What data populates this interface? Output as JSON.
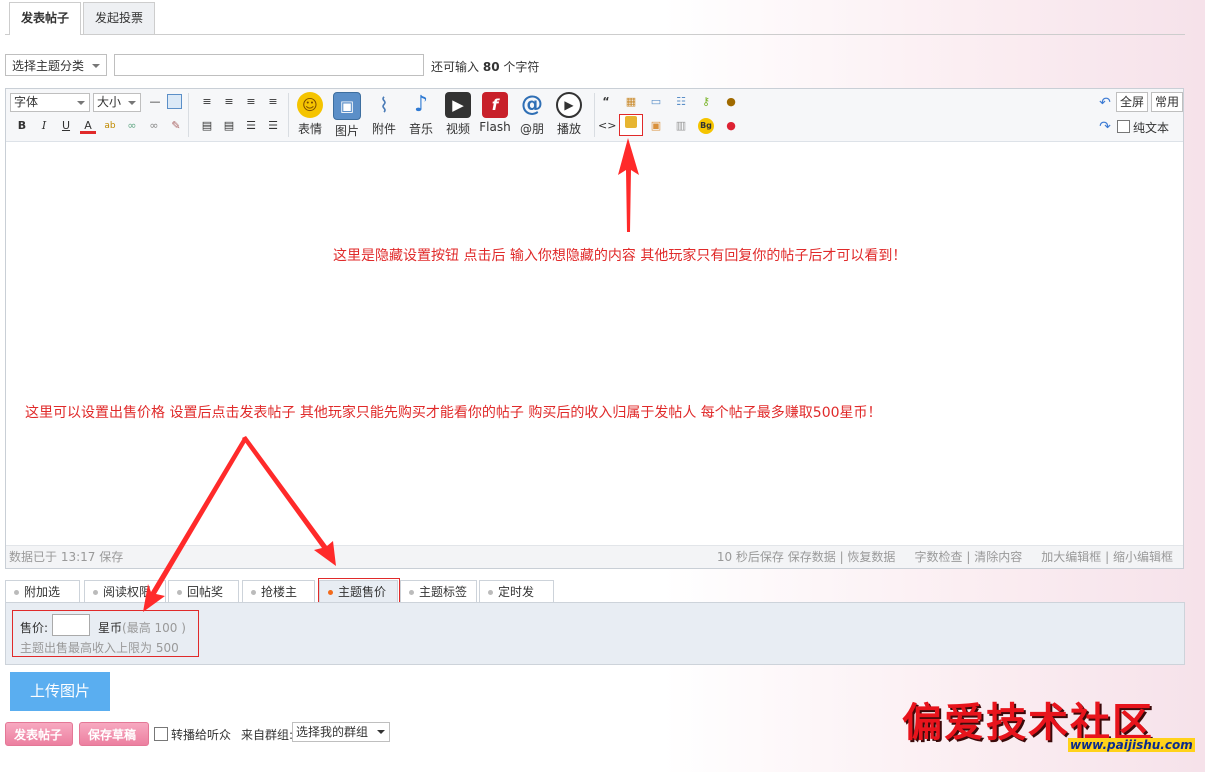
{
  "tabs": {
    "post": "发表帖子",
    "poll": "发起投票"
  },
  "subject": {
    "category": "选择主题分类",
    "hint_prefix": "还可输入",
    "hint_count": "80",
    "hint_suffix": "个字符"
  },
  "toolbar": {
    "font": "字体",
    "size": "大小",
    "big": [
      "表情",
      "图片",
      "附件",
      "音乐",
      "视频",
      "Flash",
      "@朋",
      "播放"
    ],
    "fullscreen": "全屏",
    "common": "常用",
    "plaintext": "纯文本"
  },
  "annotations": {
    "hide": "这里是隐藏设置按钮 点击后 输入你想隐藏的内容 其他玩家只有回复你的帖子后才可以看到！",
    "sell": "这里可以设置出售价格 设置后点击发表帖子 其他玩家只能先购买才能看你的帖子 购买后的收入归属于发帖人 每个帖子最多赚取500星币！"
  },
  "status": {
    "left": "数据已于 13:17 保存",
    "autosave": "10 秒后保存",
    "save": "保存数据",
    "restore": "恢复数据",
    "check": "字数检查",
    "clear": "清除内容",
    "enlarge": "加大编辑框",
    "shrink": "缩小编辑框"
  },
  "option_tabs": [
    "附加选项",
    "阅读权限",
    "回帖奖励",
    "抢楼主题",
    "主题售价",
    "主题标签",
    "定时发布"
  ],
  "price": {
    "label": "售价:",
    "unit": "星币",
    "max": "(最高 100 )",
    "note": "主题出售最高收入上限为 500"
  },
  "upload": "上传图片",
  "bottom": {
    "post": "发表帖子",
    "draft": "保存草稿",
    "broadcast": "转播给听众",
    "group_label": "来自群组:",
    "group_select": "选择我的群组"
  },
  "watermark": {
    "text": "偏爱技术社区",
    "url": "www.paijishu.com"
  },
  "colors": {
    "annotation": "#e02a2a",
    "upload": "#5aaef0",
    "pink": "#ec7fa0"
  }
}
